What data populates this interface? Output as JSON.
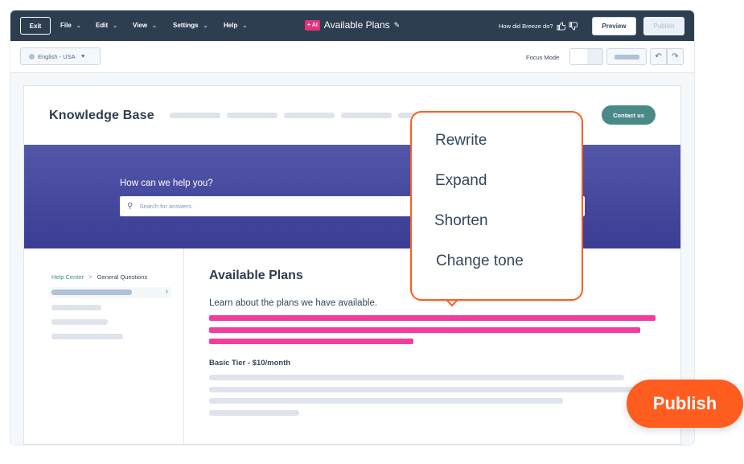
{
  "topbar": {
    "exit_label": "Exit",
    "menu": [
      {
        "label": "File"
      },
      {
        "label": "Edit"
      },
      {
        "label": "View"
      },
      {
        "label": "Settings"
      },
      {
        "label": "Help"
      }
    ],
    "ai_badge": "+ AI",
    "doc_title": "Available Plans",
    "breeze_prompt": "How did Breeze do?",
    "preview_label": "Preview",
    "publish_label": "Publish"
  },
  "toolbar": {
    "language": "English - USA",
    "focus_mode_label": "Focus Mode"
  },
  "page": {
    "kb_title": "Knowledge Base",
    "contact_label": "Contact us",
    "hero_question": "How can we help you?",
    "search_placeholder": "Search for answers",
    "breadcrumb": {
      "link": "Help Center",
      "separator": ">",
      "current": "General Questions"
    },
    "article_title": "Available Plans",
    "article_subtitle": "Learn about the plans we have available.",
    "tier_title": "Basic Tier - $10/month"
  },
  "popup": {
    "items": [
      "Rewrite",
      "Expand",
      "Shorten",
      "Change tone"
    ]
  },
  "publish_button": "Publish",
  "colors": {
    "topbar": "#2d3e50",
    "accent_orange": "#ff5c1f",
    "highlight_pink": "#f23d9c",
    "hero_purple": "#4a4da0",
    "contact_teal": "#4a8a86",
    "ai_badge_pink": "#e5317a"
  },
  "icons": {
    "language": "globe-icon",
    "search": "search-icon",
    "edit": "pencil-icon",
    "feedback_positive": "thumbs-up-icon",
    "feedback_negative": "thumbs-down-icon",
    "undo": "undo-icon",
    "redo": "redo-icon"
  }
}
